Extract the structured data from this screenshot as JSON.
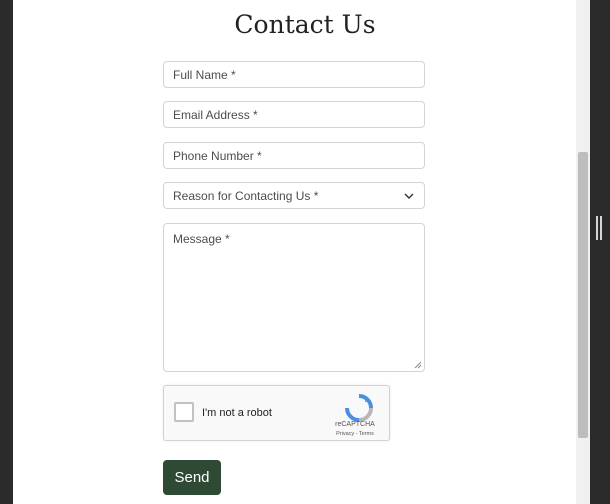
{
  "page": {
    "title": "Contact Us"
  },
  "form": {
    "full_name_placeholder": "Full Name *",
    "email_placeholder": "Email Address *",
    "phone_placeholder": "Phone Number *",
    "reason_label": "Reason for Contacting Us *",
    "message_placeholder": "Message *",
    "send_label": "Send"
  },
  "captcha": {
    "label": "I'm not a robot",
    "brand": "reCAPTCHA",
    "links": "Privacy - Terms",
    "icon": "recaptcha-logo-icon"
  },
  "colors": {
    "send_button": "#2f4a34",
    "page_bg": "#ffffff",
    "side_bg": "#2b2b2b"
  }
}
